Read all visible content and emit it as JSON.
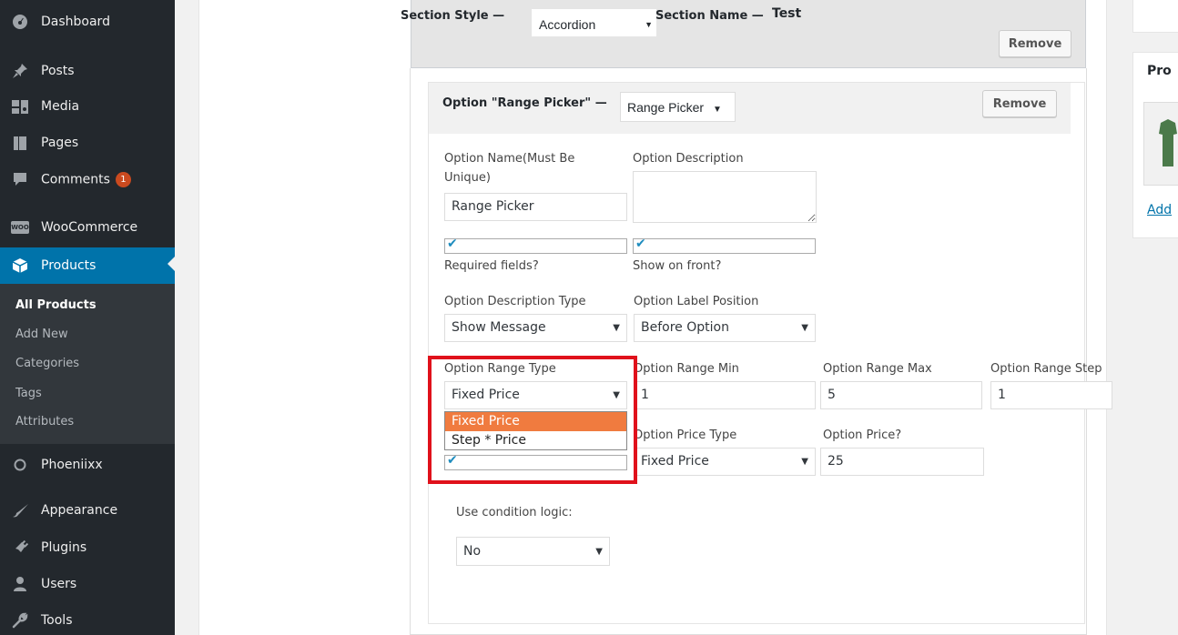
{
  "sidebar": {
    "items": [
      {
        "label": "Dashboard",
        "icon": "dashboard-icon"
      },
      {
        "label": "Posts",
        "icon": "pin-icon"
      },
      {
        "label": "Media",
        "icon": "media-icon"
      },
      {
        "label": "Pages",
        "icon": "pages-icon"
      },
      {
        "label": "Comments",
        "icon": "comments-icon",
        "badge": "1"
      },
      {
        "label": "WooCommerce",
        "icon": "woo-icon",
        "logo_text": "WOO"
      },
      {
        "label": "Products",
        "icon": "products-icon"
      },
      {
        "label": "Phoeniixx",
        "icon": "circle-icon"
      },
      {
        "label": "Appearance",
        "icon": "brush-icon"
      },
      {
        "label": "Plugins",
        "icon": "plug-icon"
      },
      {
        "label": "Users",
        "icon": "user-icon"
      },
      {
        "label": "Tools",
        "icon": "wrench-icon"
      }
    ],
    "submenu": [
      "All Products",
      "Add New",
      "Categories",
      "Tags",
      "Attributes"
    ]
  },
  "section": {
    "style_label": "Section Style —",
    "style_value": "Accordion",
    "name_label": "Section Name —",
    "name_value": "Test",
    "remove_label": "Remove"
  },
  "option": {
    "title": "Option \"Range Picker\" —",
    "type_value": "Range Picker",
    "remove_label": "Remove",
    "name_label": "Option Name(Must Be Unique)",
    "name_value": "Range Picker",
    "desc_label": "Option Description",
    "desc_value": "",
    "required_label": "Required fields?",
    "show_front_label": "Show on front?",
    "desc_type_label": "Option Description Type",
    "desc_type_value": "Show Message",
    "label_pos_label": "Option Label Position",
    "label_pos_value": "Before Option",
    "range_type_label": "Option Range Type",
    "range_type_value": "Fixed Price",
    "range_type_options": [
      "Fixed Price",
      "Step * Price"
    ],
    "range_min_label": "Option Range Min",
    "range_min_value": "1",
    "range_max_label": "Option Range Max",
    "range_max_value": "5",
    "range_step_label": "Option Range Step",
    "range_step_value": "1",
    "price_type_label": "Option Price Type",
    "price_type_value": "Fixed Price",
    "price_label": "Option Price?",
    "price_value": "25",
    "condition_label": "Use condition logic:",
    "condition_value": "No"
  },
  "right_panel": {
    "title": "Pro",
    "link": "Add"
  },
  "colors": {
    "sidebar_bg": "#23282d",
    "active_blue": "#0073aa",
    "highlight_orange": "#f07b3f",
    "annotation_red": "#e0111b",
    "badge_orange": "#ca4a1f"
  }
}
